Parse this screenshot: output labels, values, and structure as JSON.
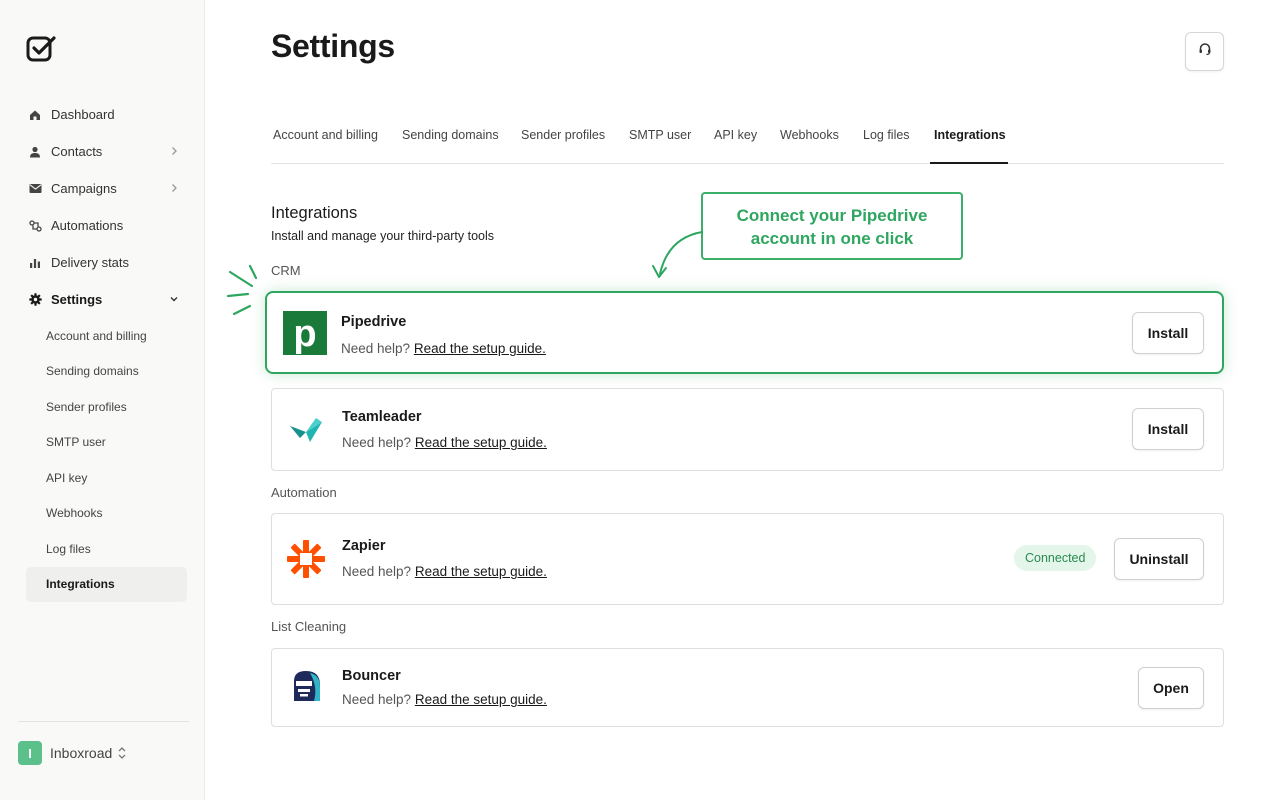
{
  "app": {
    "workspace_name": "Inboxroad",
    "workspace_initial": "I"
  },
  "sidebar": {
    "items": [
      {
        "label": "Dashboard",
        "icon": "home-icon",
        "has_chevron": false
      },
      {
        "label": "Contacts",
        "icon": "user-icon",
        "has_chevron": true
      },
      {
        "label": "Campaigns",
        "icon": "mail-icon",
        "has_chevron": true
      },
      {
        "label": "Automations",
        "icon": "automation-icon",
        "has_chevron": false
      },
      {
        "label": "Delivery stats",
        "icon": "bar-chart-icon",
        "has_chevron": false
      },
      {
        "label": "Settings",
        "icon": "gear-icon",
        "has_chevron": true,
        "expanded": true
      }
    ],
    "settings_sub": [
      "Account and billing",
      "Sending domains",
      "Sender profiles",
      "SMTP user",
      "API key",
      "Webhooks",
      "Log files",
      "Integrations"
    ],
    "active_sub": "Integrations"
  },
  "header": {
    "title": "Settings",
    "support_icon": "headset-icon"
  },
  "tabs": [
    "Account and billing",
    "Sending domains",
    "Sender profiles",
    "SMTP user",
    "API key",
    "Webhooks",
    "Log files",
    "Integrations"
  ],
  "active_tab": "Integrations",
  "integrations": {
    "title": "Integrations",
    "subtitle": "Install and manage your third-party tools",
    "groups": {
      "crm": "CRM",
      "automation": "Automation",
      "list_cleaning": "List Cleaning"
    },
    "help_prefix": "Need help?",
    "help_link": "Read the setup guide.",
    "items": [
      {
        "name": "Pipedrive",
        "action": "Install",
        "highlighted": true,
        "logo": "pipedrive-logo"
      },
      {
        "name": "Teamleader",
        "action": "Install",
        "logo": "teamleader-logo"
      },
      {
        "name": "Zapier",
        "action": "Uninstall",
        "status": "Connected",
        "logo": "zapier-logo"
      },
      {
        "name": "Bouncer",
        "action": "Open",
        "logo": "bouncer-logo"
      }
    ]
  },
  "callout": {
    "line1": "Connect your Pipedrive",
    "line2": "account in one click"
  },
  "colors": {
    "accent_green": "#2fa660",
    "pipedrive_green": "#1a7a3a",
    "zapier_orange": "#ff4f00",
    "teamleader_teal": "#1fb5b0",
    "bouncer_navy": "#1e2a5a"
  }
}
